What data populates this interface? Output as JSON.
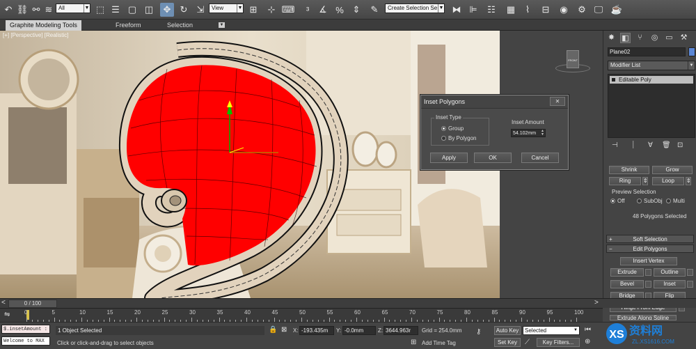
{
  "toolbar": {
    "selection_filter": "All",
    "reference_coord": "View",
    "named_selection": "Create Selection Se"
  },
  "ribbon": {
    "tabs": [
      "Graphite Modeling Tools",
      "Freeform",
      "Selection"
    ]
  },
  "viewport": {
    "label": "[+] [Perspective] [Realistic]",
    "viewcube_label": "FRONT",
    "colors": {
      "fill": "#ff0000",
      "wire": "#111111",
      "rim": "#e2d3bd"
    }
  },
  "inset_dialog": {
    "title": "Inset Polygons",
    "close": "✕",
    "group_title": "Inset Type",
    "options": [
      "Group",
      "By Polygon"
    ],
    "selected_option": "Group",
    "amount_label": "Inset Amount",
    "amount_value": "54.102mm",
    "buttons": {
      "apply": "Apply",
      "ok": "OK",
      "cancel": "Cancel"
    }
  },
  "command_panel": {
    "object_name": "Plane02",
    "object_color": "#5b87d6",
    "modifier_list": "Modifier List",
    "stack": [
      "Editable Poly"
    ],
    "selection": {
      "shrink": "Shrink",
      "grow": "Grow",
      "ring": "Ring",
      "loop": "Loop",
      "preview_title": "Preview Selection",
      "preview_options": [
        "Off",
        "SubObj",
        "Multi"
      ],
      "preview_selected": "Off",
      "count": "48 Polygons Selected"
    },
    "soft_selection": "Soft Selection",
    "edit_polygons": "Edit Polygons",
    "insert_vertex": "Insert Vertex",
    "buttons": {
      "extrude": "Extrude",
      "outline": "Outline",
      "bevel": "Bevel",
      "inset": "Inset",
      "bridge": "Bridge",
      "flip": "Flip",
      "hinge": "Hinge From Edge",
      "extrude_spline": "Extrude Along Spline"
    }
  },
  "timeline": {
    "slider": "0 / 100",
    "ticks": [
      "0",
      "5",
      "10",
      "15",
      "20",
      "25",
      "30",
      "35",
      "40",
      "45",
      "50",
      "55",
      "60",
      "65",
      "70",
      "75",
      "80",
      "85",
      "90",
      "95",
      "100"
    ]
  },
  "status": {
    "maxscript_line1": "$.insetAmount :",
    "maxscript_line2": "Welcome to MAX",
    "objects_selected": "1 Object Selected",
    "prompt": "Click or click-and-drag to select objects",
    "x_label": "X:",
    "x_value": "-193.435m",
    "y_label": "Y:",
    "y_value": "-0.0mm",
    "z_label": "Z:",
    "z_value": "3644.963r",
    "grid": "Grid = 254.0mm",
    "add_time_tag": "Add Time Tag",
    "auto_key": "Auto Key",
    "set_key": "Set Key",
    "key_mode": "Selected",
    "key_filters": "Key Filters..."
  },
  "watermark": {
    "brand": "资料网",
    "url": "ZL.XS1616.COM"
  }
}
